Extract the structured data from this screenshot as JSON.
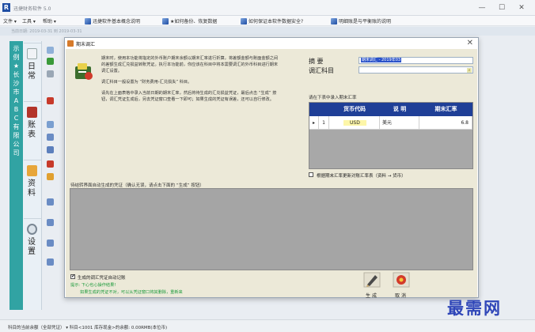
{
  "app": {
    "title": "迅捷财务软件 5.0",
    "logo": "R",
    "controls": [
      "—",
      "☐",
      "✕"
    ]
  },
  "menu": {
    "items": [
      "文件 ▾",
      "工具 ▾",
      "帮助 ▾"
    ],
    "links": [
      "迅捷软件基本概念说明",
      "★如何备份、恢复数据",
      "如何保证本软件数据安全?",
      "明细账是与平衡账的说明"
    ]
  },
  "toolbar": {
    "date_text": "当前日期: 2019-03-31 到 2019-03-31"
  },
  "side": {
    "strip_text": [
      "示",
      "例",
      "★",
      "长",
      "沙",
      "市",
      "A",
      "B",
      "C",
      "有",
      "限",
      "公",
      "司"
    ],
    "tabs": [
      {
        "label": "日常",
        "icon": "calendar-icon"
      },
      {
        "label": "账表",
        "icon": "ledger-icon"
      },
      {
        "label": "资料",
        "icon": "folder-icon"
      },
      {
        "label": "设置",
        "icon": "gear-icon"
      }
    ]
  },
  "dialog": {
    "title": "期末调汇",
    "close": "✕",
    "instructions": [
      "期末时，使用本功能将指定的外币账户期末余额以期末汇率进行折算，将差额金额与账面金额之间的差额生成汇兑损益转账凭证。执行本功能前，你应该在科目中将本需要调汇的外币科目进行期末调汇设置。",
      "调汇科目一般设置为 “财务费用-汇兑损失” 科目。",
      "请先在上面表格中录入当前日期的期末汇率，然后将待生成的汇兑损益凭证，最后点击 “生成” 按钮，调汇凭证生成后，另去凭证窗口查看一下即可；如果生成的凭证有误差，还可以自行修改。"
    ],
    "summary_label": "摘 要",
    "summary_value": "期末调汇 - 2019年03",
    "account_label": "调汇科目",
    "account_value": "",
    "grid_caption": "请在下表中录入期末汇率",
    "grid_headers": [
      "货币代码",
      "说 明",
      "期末汇率"
    ],
    "grid_rows": [
      {
        "pointer": "▸",
        "index": "1",
        "code": "USD",
        "desc": "美元",
        "rate": "6.8"
      }
    ],
    "auto_check_label": "根据期末汇率更新对账汇率表（资料 → 货币）",
    "auto_check_checked": false,
    "voucher_section_label": "待结转界面自动生成的凭证（确认无误，请点击下面的 “生成” 按钮）",
    "record_check_label": "生成的调汇凭证自动记账",
    "record_check_checked": true,
    "tip_line1": "提示: 下心也心操作结果!",
    "tip_line2": "如果生成的凭证不对，可以从凭证窗口将其删除，重新来",
    "generate_label": "生成",
    "cancel_label": "取消"
  },
  "status": {
    "text": "科目的当前余额（全部凭证）  ▾  科目<1001 库存现金>的余额: 0.00RMB(本位币)"
  },
  "watermark": "最需网",
  "colors": {
    "accent": "#1f3f97",
    "teal": "#31a3a3",
    "dialog_bg": "#ece9d8",
    "tip": "#1a9a3a",
    "watermark": "#2f46b8"
  }
}
